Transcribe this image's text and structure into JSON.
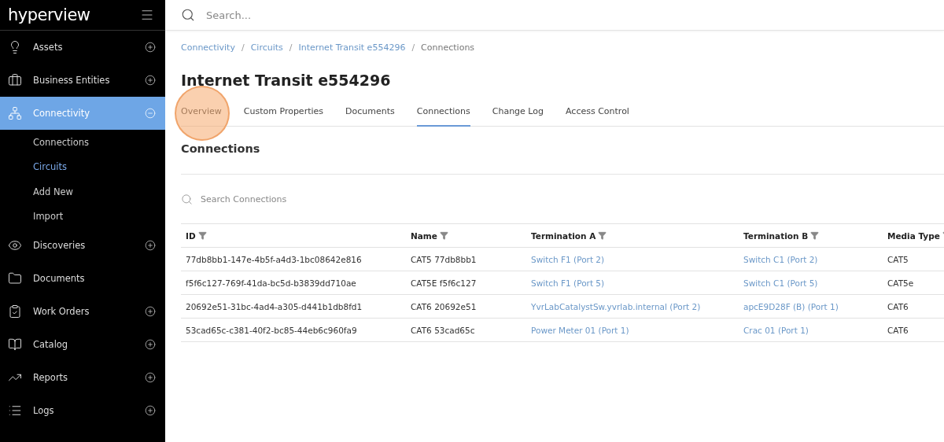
{
  "sidebar": {
    "logo": "hyperview",
    "items": [
      {
        "label": "Assets",
        "kind": "expandable",
        "selected": false,
        "expanded": false
      },
      {
        "label": "Business Entities",
        "kind": "expandable",
        "selected": false,
        "expanded": false
      },
      {
        "label": "Connectivity",
        "kind": "expandable",
        "selected": true,
        "expanded": true,
        "children": [
          {
            "label": "Connections",
            "selected": false
          },
          {
            "label": "Circuits",
            "selected": true
          },
          {
            "label": "Add New",
            "selected": false
          },
          {
            "label": "Import",
            "selected": false
          }
        ]
      },
      {
        "label": "Discoveries",
        "kind": "expandable",
        "selected": false,
        "expanded": false
      },
      {
        "label": "Documents",
        "kind": "plain",
        "selected": false
      },
      {
        "label": "Work Orders",
        "kind": "expandable",
        "selected": false,
        "expanded": false
      },
      {
        "label": "Catalog",
        "kind": "expandable",
        "selected": false,
        "expanded": false
      },
      {
        "label": "Reports",
        "kind": "expandable",
        "selected": false,
        "expanded": false
      },
      {
        "label": "Logs",
        "kind": "expandable",
        "selected": false,
        "expanded": false
      }
    ]
  },
  "search": {
    "placeholder": "Search..."
  },
  "breadcrumbs": [
    {
      "label": "Connectivity",
      "kind": "link"
    },
    {
      "label": "/",
      "kind": "separator"
    },
    {
      "label": "Circuits",
      "kind": "link"
    },
    {
      "label": "/",
      "kind": "separator"
    },
    {
      "label": "Internet Transit e554296",
      "kind": "link"
    },
    {
      "label": "/",
      "kind": "separator"
    },
    {
      "label": "Connections",
      "kind": "current"
    }
  ],
  "title": "Internet Transit e554296",
  "tabs": [
    {
      "label": "Overview",
      "selected": false,
      "highlighted": true
    },
    {
      "label": "Custom Properties",
      "selected": false,
      "highlighted": false
    },
    {
      "label": "Documents",
      "selected": false,
      "highlighted": false
    },
    {
      "label": "Connections",
      "selected": true,
      "highlighted": false
    },
    {
      "label": "Change Log",
      "selected": false,
      "highlighted": false
    },
    {
      "label": "Access Control",
      "selected": false,
      "highlighted": false
    }
  ],
  "section_title": "Connections",
  "table_search": {
    "placeholder": "Search Connections"
  },
  "table": {
    "columns": [
      {
        "label": "ID",
        "kind": "text"
      },
      {
        "label": "Name",
        "kind": "text"
      },
      {
        "label": "Termination A",
        "kind": "link"
      },
      {
        "label": "Termination B",
        "kind": "link"
      },
      {
        "label": "Media Type",
        "kind": "text"
      }
    ],
    "rows": [
      [
        "77db8bb1-147e-4b5f-a4d3-1bc08642e816",
        "CAT5 77db8bb1",
        "Switch F1 (Port 2)",
        "Switch C1 (Port 2)",
        "CAT5"
      ],
      [
        "f5f6c127-769f-41da-bc5d-b3839dd710ae",
        "CAT5E f5f6c127",
        "Switch F1 (Port 5)",
        "Switch C1 (Port 5)",
        "CAT5e"
      ],
      [
        "20692e51-31bc-4ad4-a305-d441b1db8fd1",
        "CAT6 20692e51",
        "YvrLabCatalystSw.yvrlab.internal (Port 2)",
        "apcE9D28F (B) (Port 1)",
        "CAT6"
      ],
      [
        "53cad65c-c381-40f2-bc85-44eb6c960fa9",
        "CAT6 53cad65c",
        "Power Meter 01 (Port 1)",
        "Crac 01 (Port 1)",
        "CAT6"
      ]
    ]
  }
}
